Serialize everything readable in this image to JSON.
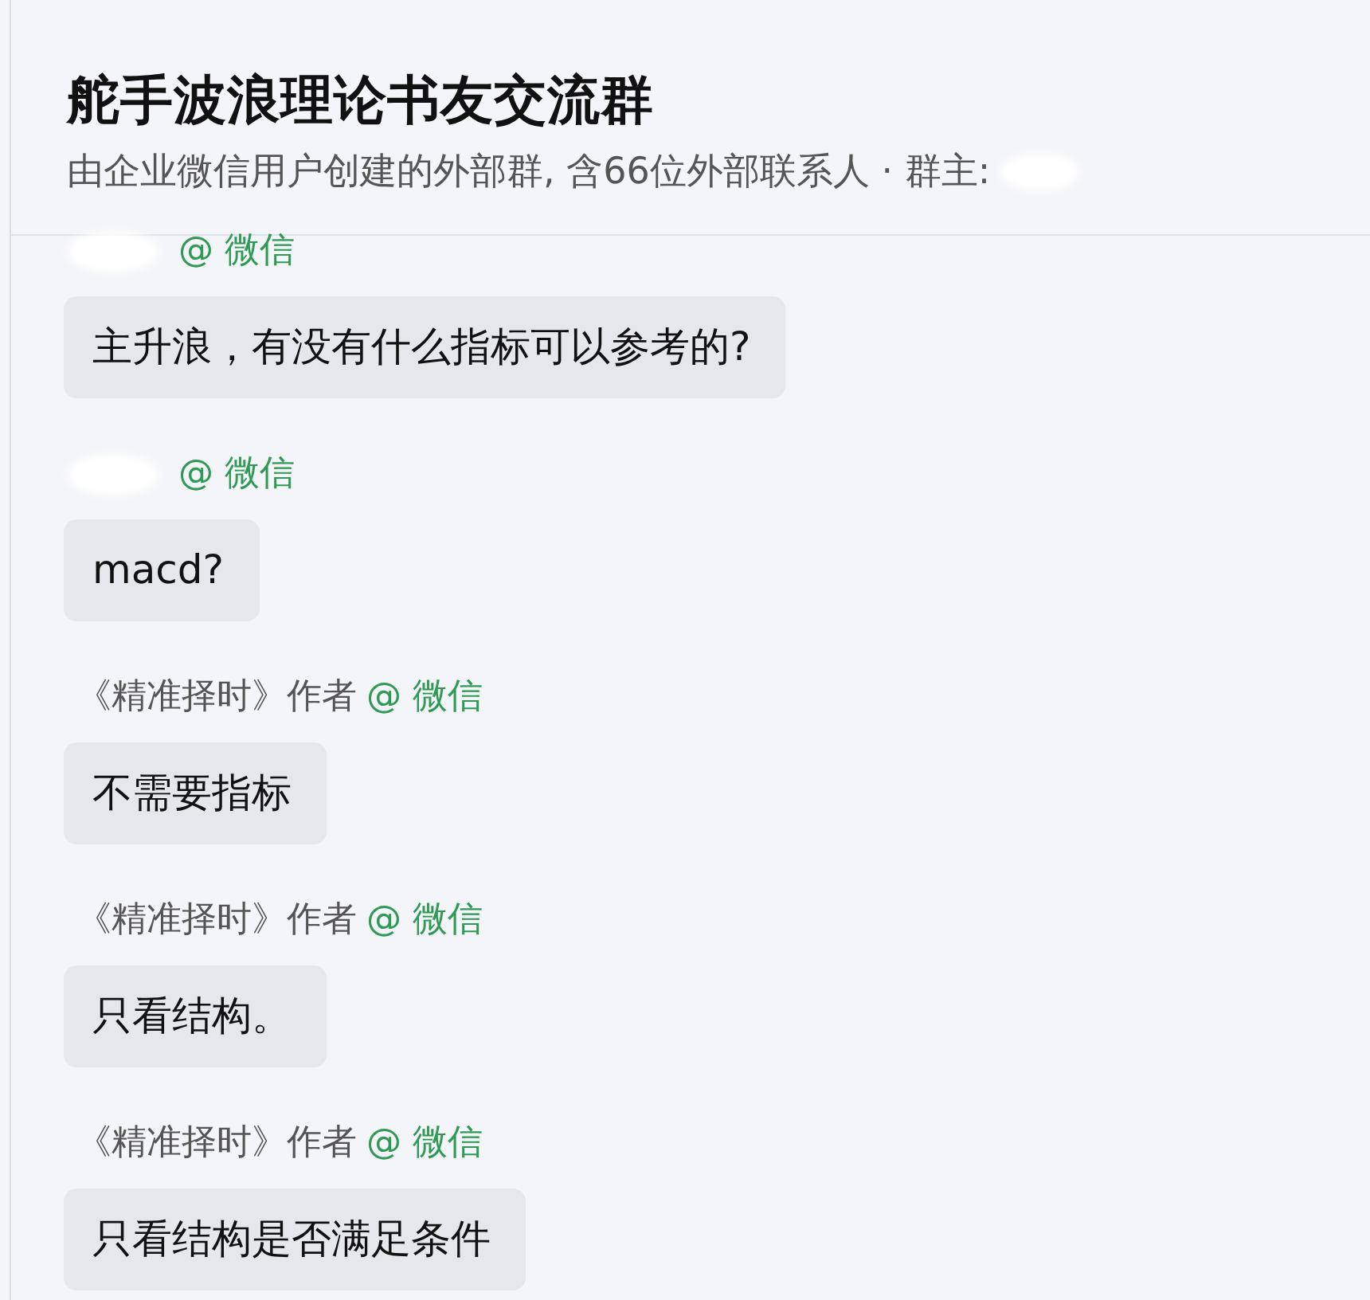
{
  "header": {
    "title": "舵手波浪理论书友交流群",
    "subtitle": "由企业微信用户创建的外部群, 含66位外部联系人 · 群主:",
    "owner_redacted": true
  },
  "messages": [
    {
      "sender_redacted": true,
      "source": "@ 微信",
      "text": "主升浪，有没有什么指标可以参考的?"
    },
    {
      "sender_redacted": true,
      "source": "@ 微信",
      "text": "macd?"
    },
    {
      "sender": "《精准择时》作者",
      "sender_redacted": false,
      "source": "@ 微信",
      "text": "不需要指标"
    },
    {
      "sender": "《精准择时》作者",
      "sender_redacted": false,
      "source": "@ 微信",
      "text": "只看结构。"
    },
    {
      "sender": "《精准择时》作者",
      "sender_redacted": false,
      "source": "@ 微信",
      "text": "只看结构是否满足条件"
    }
  ]
}
